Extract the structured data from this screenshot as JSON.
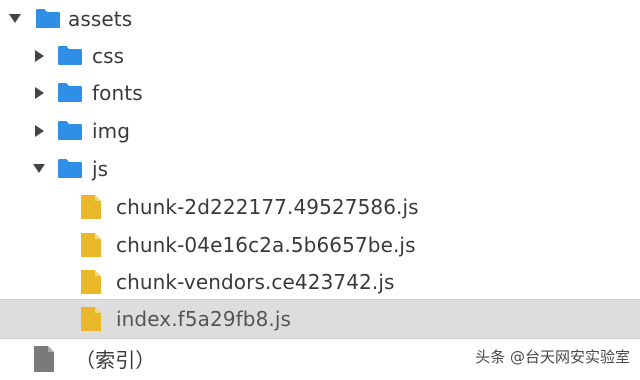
{
  "tree": {
    "items": [
      {
        "label": "assets",
        "kind": "folder",
        "expanded": true
      },
      {
        "label": "css",
        "kind": "folder",
        "expanded": false
      },
      {
        "label": "fonts",
        "kind": "folder",
        "expanded": false
      },
      {
        "label": "img",
        "kind": "folder",
        "expanded": false
      },
      {
        "label": "js",
        "kind": "folder",
        "expanded": true
      },
      {
        "label": "chunk-2d222177.49527586.js",
        "kind": "js-file"
      },
      {
        "label": "chunk-04e16c2a.5b6657be.js",
        "kind": "js-file"
      },
      {
        "label": "chunk-vendors.ce423742.js",
        "kind": "js-file"
      },
      {
        "label": "index.f5a29fb8.js",
        "kind": "js-file",
        "selected": true
      },
      {
        "label": "（索引）",
        "kind": "document"
      }
    ]
  },
  "watermark": {
    "text": "头条 @台天网安实验室"
  },
  "colors": {
    "folder": "#2f8fe6",
    "js_file": "#e8b82a",
    "document": "#7a7a7a",
    "arrow": "#444444",
    "selected_row": "#dddddd"
  }
}
